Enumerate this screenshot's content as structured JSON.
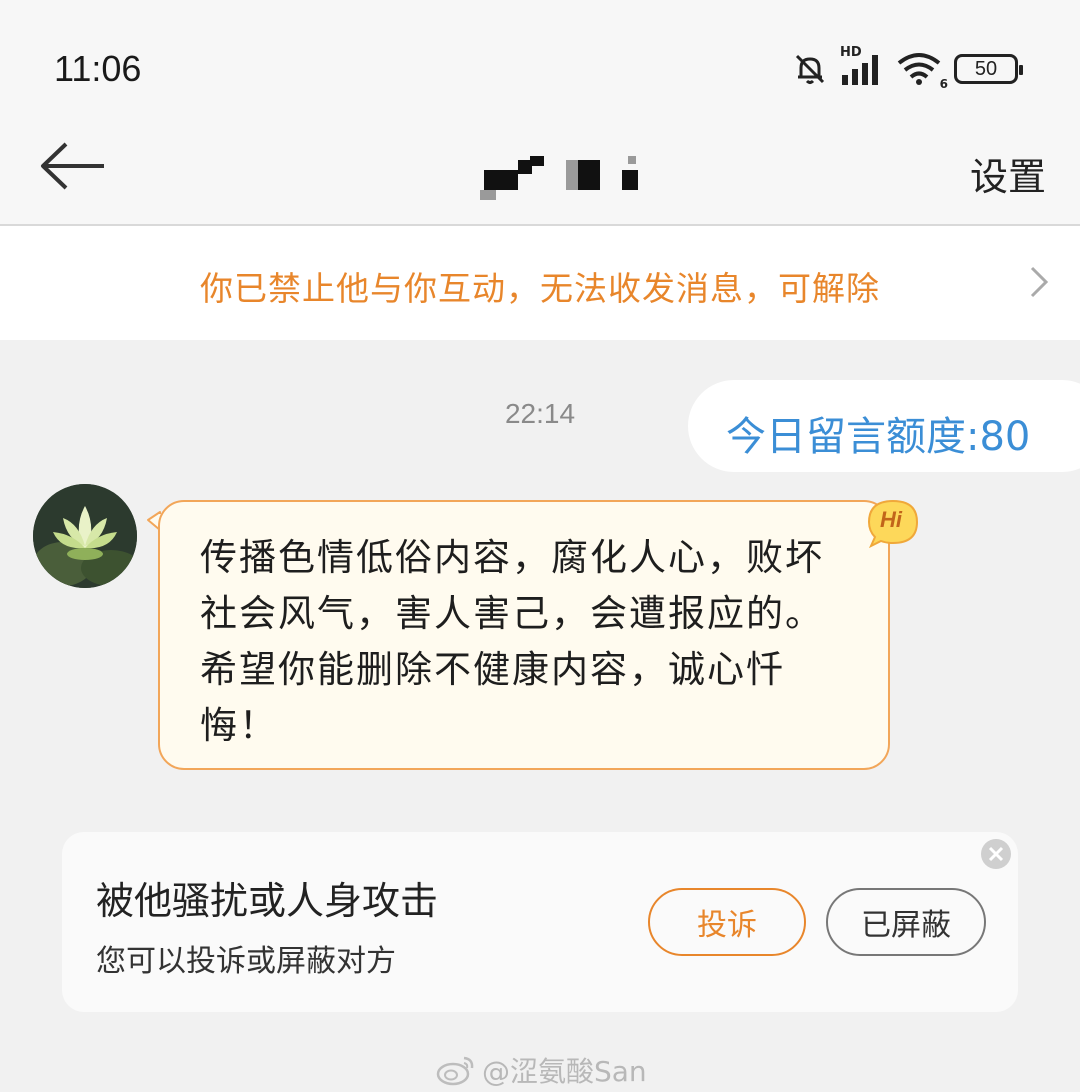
{
  "status_bar": {
    "time": "11:06",
    "network_label": "HD",
    "wifi_badge": "6",
    "battery_level": "50",
    "icons": [
      "bell-muted-icon",
      "signal-icon",
      "wifi-icon",
      "battery-icon"
    ]
  },
  "nav": {
    "back_icon": "arrow-left-icon",
    "settings_label": "设置"
  },
  "banner": {
    "text": "你已禁止他与你互动，无法收发消息，可解除",
    "color": "#e8862b"
  },
  "chat": {
    "timestamp": "22:14",
    "quota_text": "今日留言额度:80",
    "quota_color": "#3b8ed6",
    "incoming_message": "传播色情低俗内容，腐化人心，败坏社会风气，害人害己，会遭报应的。希望你能删除不健康内容，诚心忏悔！",
    "hi_badge": "Hi"
  },
  "report_card": {
    "title": "被他骚扰或人身攻击",
    "subtitle": "您可以投诉或屏蔽对方",
    "report_button": "投诉",
    "block_button": "已屏蔽"
  },
  "watermark": {
    "text": "@涩氨酸San"
  }
}
